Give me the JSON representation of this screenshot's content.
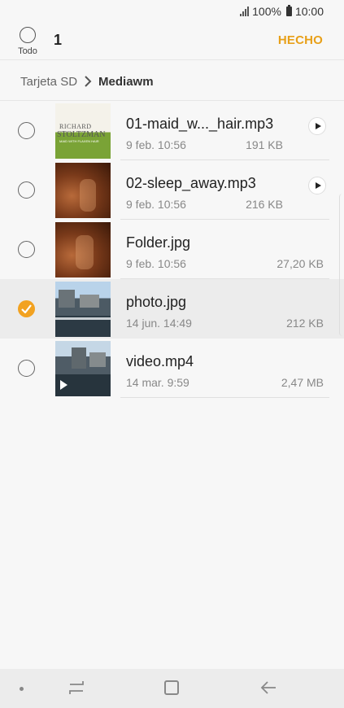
{
  "status": {
    "battery": "100%",
    "time": "10:00"
  },
  "header": {
    "select_all_label": "Todo",
    "selected_count": "1",
    "done_label": "HECHO"
  },
  "breadcrumb": {
    "root": "Tarjeta SD",
    "current": "Mediawm"
  },
  "files": [
    {
      "name": "01-maid_w..._hair.mp3",
      "date": "9 feb. 10:56",
      "size": "191 KB",
      "selected": false,
      "type": "audio"
    },
    {
      "name": "02-sleep_away.mp3",
      "date": "9 feb. 10:56",
      "size": "216 KB",
      "selected": false,
      "type": "audio"
    },
    {
      "name": "Folder.jpg",
      "date": "9 feb. 10:56",
      "size": "27,20 KB",
      "selected": false,
      "type": "image"
    },
    {
      "name": "photo.jpg",
      "date": "14 jun. 14:49",
      "size": "212 KB",
      "selected": true,
      "type": "image"
    },
    {
      "name": "video.mp4",
      "date": "14 mar. 9:59",
      "size": "2,47 MB",
      "selected": false,
      "type": "video"
    }
  ],
  "album_art": {
    "line1": "RICHARD",
    "line2": "STOLTZMAN",
    "line3": "MAID WITH FLAXEN HAIR"
  },
  "colors": {
    "accent": "#f2a221",
    "done": "#e8a019"
  }
}
